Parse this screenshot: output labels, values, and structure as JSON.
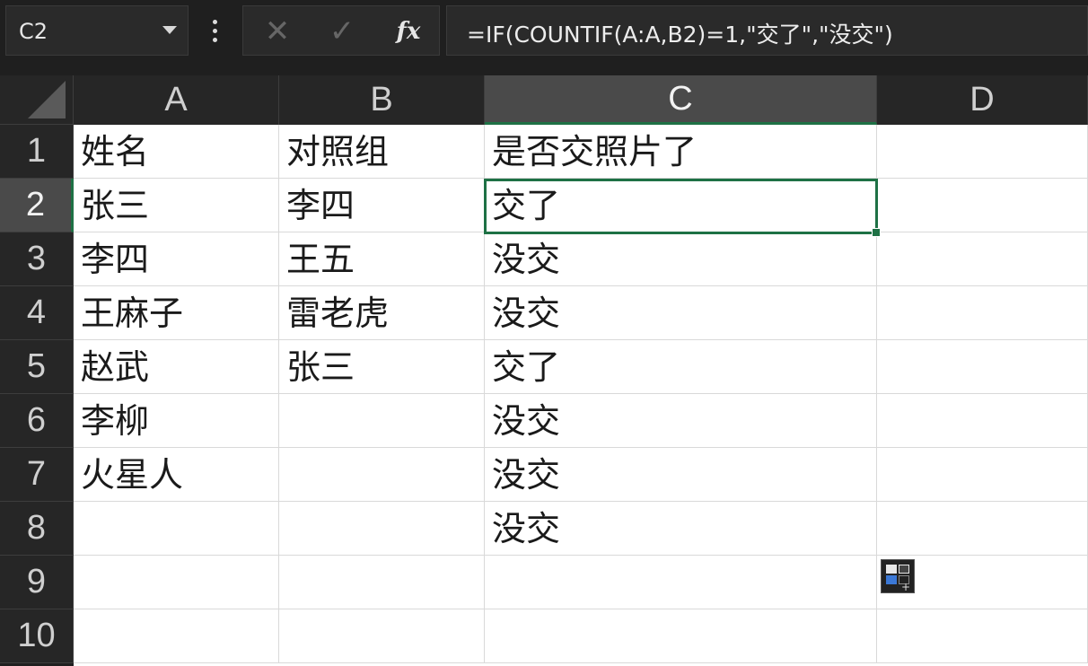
{
  "name_box": {
    "value": "C2"
  },
  "formula_bar": {
    "cancel_glyph": "✕",
    "enter_glyph": "✓",
    "fx_label": "fx",
    "formula": "=IF(COUNTIF(A:A,B2)=1,\"交了\",\"没交\")"
  },
  "columns": [
    "A",
    "B",
    "C",
    "D"
  ],
  "active_column": "C",
  "rows": [
    "1",
    "2",
    "3",
    "4",
    "5",
    "6",
    "7",
    "8",
    "9",
    "10"
  ],
  "active_row": "2",
  "cells": {
    "A": [
      "姓名",
      "张三",
      "李四",
      "王麻子",
      "赵武",
      "李柳",
      "火星人",
      "",
      "",
      ""
    ],
    "B": [
      "对照组",
      "李四",
      "王五",
      "雷老虎",
      "张三",
      "",
      "",
      "",
      "",
      ""
    ],
    "C": [
      "是否交照片了",
      "交了",
      "没交",
      "没交",
      "交了",
      "没交",
      "没交",
      "没交",
      "",
      ""
    ],
    "D": [
      "",
      "",
      "",
      "",
      "",
      "",
      "",
      "",
      "",
      ""
    ]
  },
  "colors": {
    "selection": "#1e7145",
    "header_bg": "#262626",
    "active_header_bg": "#4a4a4a"
  }
}
